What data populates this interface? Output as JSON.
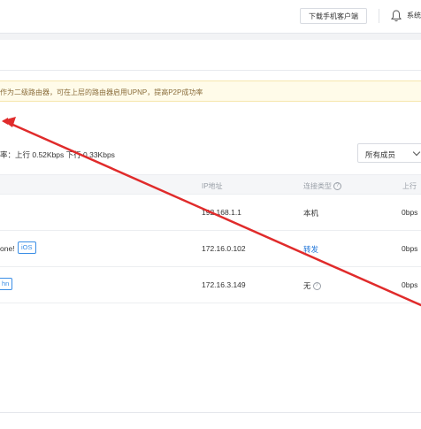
{
  "topbar": {
    "download_label": "下载手机客户端",
    "system_label": "系统",
    "bell_icon": "bell-icon"
  },
  "notice": {
    "text": "作为二级路由器，可在上层的路由器启用UPNP，提高P2P成功率"
  },
  "speed": {
    "text": "率：上行 0.52Kbps  下行 0.33Kbps"
  },
  "filter": {
    "selected": "所有成员"
  },
  "table": {
    "headers": {
      "ip": "IP地址",
      "connection": "连接类型",
      "upload": "上行"
    },
    "rows": [
      {
        "name": "",
        "badge": "",
        "ip": "192.168.1.1",
        "connection": "本机",
        "upload": "0bps"
      },
      {
        "name": "one!",
        "badge": "iOS",
        "ip": "172.16.0.102",
        "connection": "转发",
        "upload": "0bps"
      },
      {
        "name": "",
        "badge": "hn",
        "ip": "172.16.3.149",
        "connection": "无",
        "upload": "0bps"
      }
    ]
  },
  "colors": {
    "annotation_arrow": "#e02b2b",
    "accent": "#1e74d8",
    "notice_bg": "#fffbe9"
  }
}
